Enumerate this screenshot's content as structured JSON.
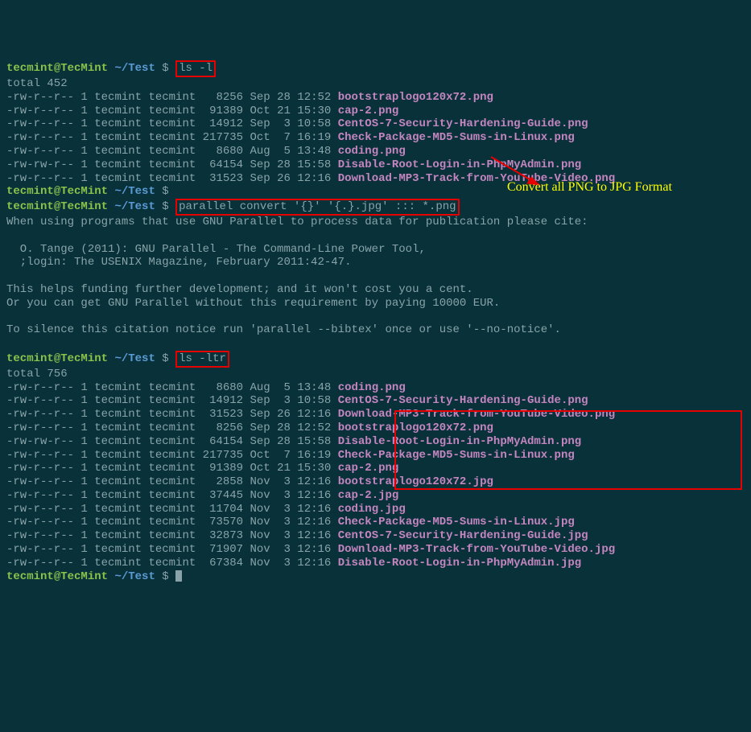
{
  "prompt": {
    "user": "tecmint",
    "host": "TecMint",
    "path": "~/Test",
    "dollar": "$"
  },
  "cmd1": "ls -l",
  "total1": "total 452",
  "files1": [
    {
      "perm": "-rw-r--r--",
      "links": "1",
      "owner": "tecmint",
      "group": "tecmint",
      "size": "   8256",
      "date": "Sep 28 12:52",
      "name": "bootstraplogo120x72.png"
    },
    {
      "perm": "-rw-r--r--",
      "links": "1",
      "owner": "tecmint",
      "group": "tecmint",
      "size": "  91389",
      "date": "Oct 21 15:30",
      "name": "cap-2.png"
    },
    {
      "perm": "-rw-r--r--",
      "links": "1",
      "owner": "tecmint",
      "group": "tecmint",
      "size": "  14912",
      "date": "Sep  3 10:58",
      "name": "CentOS-7-Security-Hardening-Guide.png"
    },
    {
      "perm": "-rw-r--r--",
      "links": "1",
      "owner": "tecmint",
      "group": "tecmint",
      "size": " 217735",
      "date": "Oct  7 16:19",
      "name": "Check-Package-MD5-Sums-in-Linux.png"
    },
    {
      "perm": "-rw-r--r--",
      "links": "1",
      "owner": "tecmint",
      "group": "tecmint",
      "size": "   8680",
      "date": "Aug  5 13:48",
      "name": "coding.png"
    },
    {
      "perm": "-rw-rw-r--",
      "links": "1",
      "owner": "tecmint",
      "group": "tecmint",
      "size": "  64154",
      "date": "Sep 28 15:58",
      "name": "Disable-Root-Login-in-PhpMyAdmin.png"
    },
    {
      "perm": "-rw-r--r--",
      "links": "1",
      "owner": "tecmint",
      "group": "tecmint",
      "size": "  31523",
      "date": "Sep 26 12:16",
      "name": "Download-MP3-Track-from-YouTube-Video.png"
    }
  ],
  "cmd2": "parallel convert '{}' '{.}.jpg' ::: *.png",
  "parallelMsg": {
    "l1": "When using programs that use GNU Parallel to process data for publication please cite:",
    "l2": "  O. Tange (2011): GNU Parallel - The Command-Line Power Tool,",
    "l3": "  ;login: The USENIX Magazine, February 2011:42-47.",
    "l4": "This helps funding further development; and it won't cost you a cent.",
    "l5": "Or you can get GNU Parallel without this requirement by paying 10000 EUR.",
    "l6": "To silence this citation notice run 'parallel --bibtex' once or use '--no-notice'."
  },
  "cmd3": "ls -ltr",
  "total2": "total 756",
  "files2": [
    {
      "perm": "-rw-r--r--",
      "links": "1",
      "owner": "tecmint",
      "group": "tecmint",
      "size": "   8680",
      "date": "Aug  5 13:48",
      "name": "coding.png"
    },
    {
      "perm": "-rw-r--r--",
      "links": "1",
      "owner": "tecmint",
      "group": "tecmint",
      "size": "  14912",
      "date": "Sep  3 10:58",
      "name": "CentOS-7-Security-Hardening-Guide.png"
    },
    {
      "perm": "-rw-r--r--",
      "links": "1",
      "owner": "tecmint",
      "group": "tecmint",
      "size": "  31523",
      "date": "Sep 26 12:16",
      "name": "Download-MP3-Track-from-YouTube-Video.png"
    },
    {
      "perm": "-rw-r--r--",
      "links": "1",
      "owner": "tecmint",
      "group": "tecmint",
      "size": "   8256",
      "date": "Sep 28 12:52",
      "name": "bootstraplogo120x72.png"
    },
    {
      "perm": "-rw-rw-r--",
      "links": "1",
      "owner": "tecmint",
      "group": "tecmint",
      "size": "  64154",
      "date": "Sep 28 15:58",
      "name": "Disable-Root-Login-in-PhpMyAdmin.png"
    },
    {
      "perm": "-rw-r--r--",
      "links": "1",
      "owner": "tecmint",
      "group": "tecmint",
      "size": " 217735",
      "date": "Oct  7 16:19",
      "name": "Check-Package-MD5-Sums-in-Linux.png"
    },
    {
      "perm": "-rw-r--r--",
      "links": "1",
      "owner": "tecmint",
      "group": "tecmint",
      "size": "  91389",
      "date": "Oct 21 15:30",
      "name": "cap-2.png"
    },
    {
      "perm": "-rw-r--r--",
      "links": "1",
      "owner": "tecmint",
      "group": "tecmint",
      "size": "   2858",
      "date": "Nov  3 12:16",
      "name": "bootstraplogo120x72.jpg"
    },
    {
      "perm": "-rw-r--r--",
      "links": "1",
      "owner": "tecmint",
      "group": "tecmint",
      "size": "  37445",
      "date": "Nov  3 12:16",
      "name": "cap-2.jpg"
    },
    {
      "perm": "-rw-r--r--",
      "links": "1",
      "owner": "tecmint",
      "group": "tecmint",
      "size": "  11704",
      "date": "Nov  3 12:16",
      "name": "coding.jpg"
    },
    {
      "perm": "-rw-r--r--",
      "links": "1",
      "owner": "tecmint",
      "group": "tecmint",
      "size": "  73570",
      "date": "Nov  3 12:16",
      "name": "Check-Package-MD5-Sums-in-Linux.jpg"
    },
    {
      "perm": "-rw-r--r--",
      "links": "1",
      "owner": "tecmint",
      "group": "tecmint",
      "size": "  32873",
      "date": "Nov  3 12:16",
      "name": "CentOS-7-Security-Hardening-Guide.jpg"
    },
    {
      "perm": "-rw-r--r--",
      "links": "1",
      "owner": "tecmint",
      "group": "tecmint",
      "size": "  71907",
      "date": "Nov  3 12:16",
      "name": "Download-MP3-Track-from-YouTube-Video.jpg"
    },
    {
      "perm": "-rw-r--r--",
      "links": "1",
      "owner": "tecmint",
      "group": "tecmint",
      "size": "  67384",
      "date": "Nov  3 12:16",
      "name": "Disable-Root-Login-in-PhpMyAdmin.jpg"
    }
  ],
  "annotation": "Convert all PNG to JPG Format"
}
